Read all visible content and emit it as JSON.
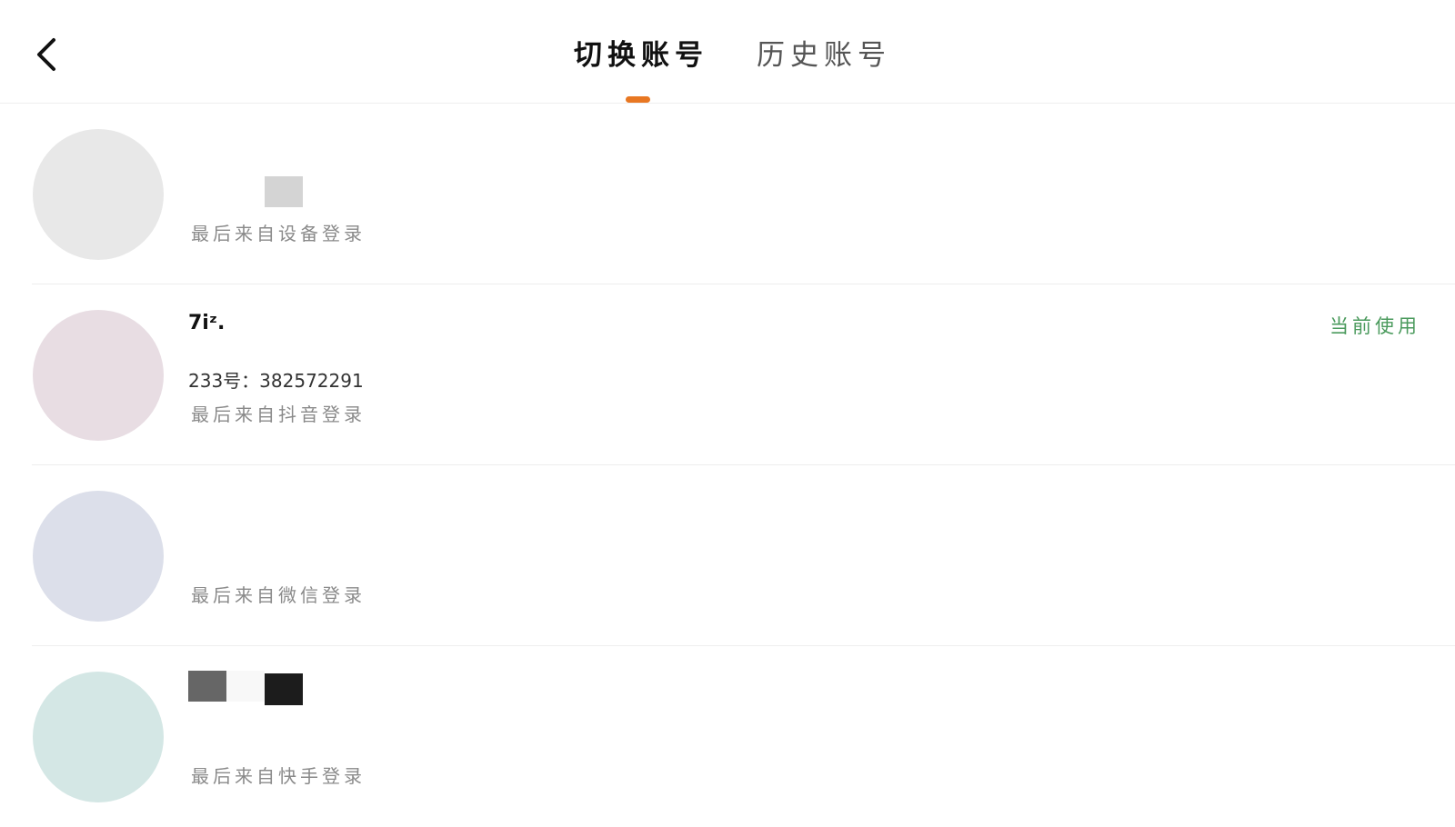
{
  "header": {
    "back_icon": "chevron-left-icon",
    "tabs": [
      {
        "label": "切换账号",
        "active": true
      },
      {
        "label": "历史账号",
        "active": false
      }
    ],
    "indicator_color": "#e87722"
  },
  "accounts": [
    {
      "name": "",
      "uid_text": "",
      "login_source": "最后来自设备登录",
      "current": false,
      "avatar_color": "#e8e8e8"
    },
    {
      "name": "7iᶻ.",
      "uid_text": "233号：382572291",
      "login_source": "最后来自抖音登录",
      "current": true,
      "current_label": "当前使用",
      "avatar_color": "#e8dde3"
    },
    {
      "name": "",
      "uid_text": "",
      "login_source": "最后来自微信登录",
      "current": false,
      "avatar_color": "#dcdfea"
    },
    {
      "name": "",
      "uid_text": "",
      "login_source": "最后来自快手登录",
      "current": false,
      "avatar_color": "#d4e7e5"
    }
  ],
  "colors": {
    "accent": "#e87722",
    "current_badge": "#4a9a5c",
    "divider": "#eeeeee"
  }
}
